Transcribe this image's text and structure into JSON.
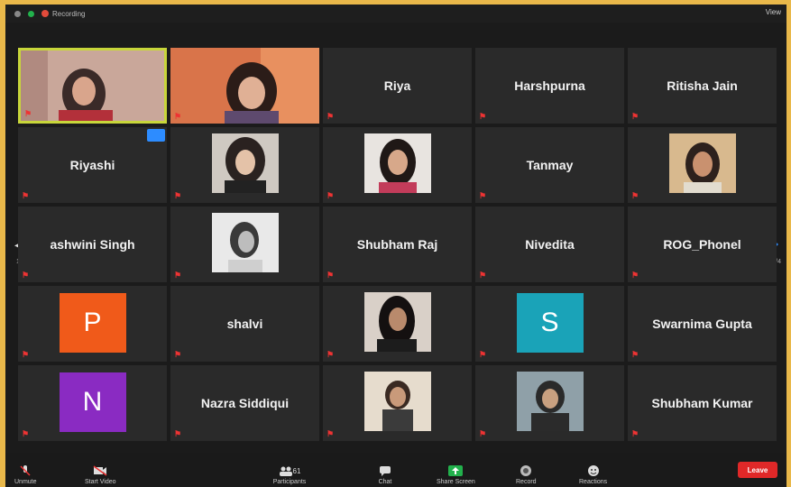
{
  "topbar": {
    "recording_label": "Recording",
    "view_label": "View"
  },
  "tiles": [
    {
      "name": "Riya"
    },
    {
      "name": "Harshpurna"
    },
    {
      "name": "Ritisha Jain"
    },
    {
      "name": "Riyashi"
    },
    {
      "name": "Tanmay"
    },
    {
      "name": "ashwini Singh"
    },
    {
      "name": "Shubham Raj"
    },
    {
      "name": "Nivedita"
    },
    {
      "name": "ROG_Phonel"
    },
    {
      "name": "shalvi"
    },
    {
      "name": "Swarnima Gupta"
    },
    {
      "name": "Nazra Siddiqui"
    },
    {
      "name": "Shubham Kumar"
    }
  ],
  "avatars": [
    {
      "letter": "P",
      "color": "#f05a1a"
    },
    {
      "letter": "S",
      "color": "#1aa3b8"
    },
    {
      "letter": "N",
      "color": "#8a2bc2"
    }
  ],
  "toolbar": {
    "unmute": "Unmute",
    "start_video": "Start Video",
    "participants": "Participants",
    "participants_count": "61",
    "chat": "Chat",
    "share_screen": "Share Screen",
    "record": "Record",
    "reactions": "Reactions",
    "leave": "Leave"
  },
  "colors": {
    "accent_green": "#22b14c",
    "leave_red": "#e02828",
    "active_border": "#c8d63a",
    "page_arrow_blue": "#2d8cff"
  }
}
